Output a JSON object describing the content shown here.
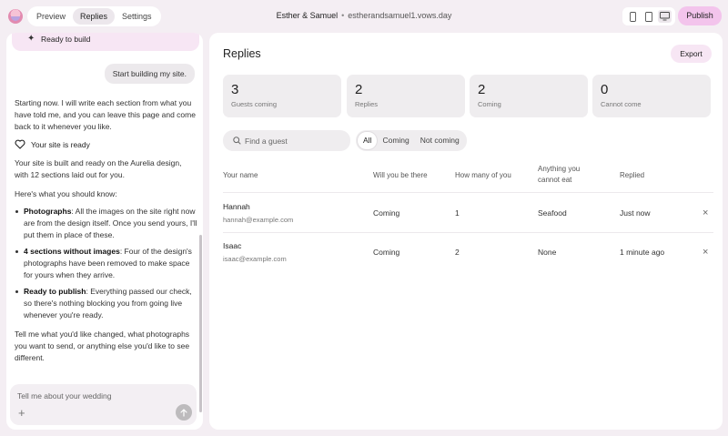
{
  "topbar": {
    "tabs": [
      {
        "label": "Preview",
        "active": false
      },
      {
        "label": "Replies",
        "active": true
      },
      {
        "label": "Settings",
        "active": false
      }
    ],
    "site_name": "Esther & Samuel",
    "separator": "•",
    "domain": "estherandsamuel1.vows.day",
    "devices": [
      "phone-icon",
      "tablet-icon",
      "desktop-icon"
    ],
    "active_device": "desktop-icon",
    "publish_label": "Publish",
    "accent_color": "#f3c4ec"
  },
  "chat": {
    "status_label": "Ready to build",
    "user_message": "Start building my site.",
    "intro": "Starting now. I will write each section from what you have told me, and you can leave this page and come back to it whenever you like.",
    "ready_label": "Your site is ready",
    "built_text": "Your site is built and ready on the Aurelia design, with 12 sections laid out for you.",
    "know_text": "Here's what you should know:",
    "bullets": [
      {
        "title": "Photographs",
        "text": ": All the images on the site right now are from the design itself. Once you send yours, I'll put them in place of these."
      },
      {
        "title": "4 sections without images",
        "text": ": Four of the design's photographs have been removed to make space for yours when they arrive."
      },
      {
        "title": "Ready to publish",
        "text": ": Everything passed our check, so there's nothing blocking you from going live whenever you're ready."
      }
    ],
    "closing": "Tell me what you'd like changed, what photographs you want to send, or anything else you'd like to see different.",
    "composer_placeholder": "Tell me about your wedding"
  },
  "replies": {
    "title": "Replies",
    "export_label": "Export",
    "stats": [
      {
        "value": "3",
        "label": "Guests coming"
      },
      {
        "value": "2",
        "label": "Replies"
      },
      {
        "value": "2",
        "label": "Coming"
      },
      {
        "value": "0",
        "label": "Cannot come"
      }
    ],
    "search_placeholder": "Find a guest",
    "filters": [
      {
        "label": "All",
        "active": true
      },
      {
        "label": "Coming",
        "active": false
      },
      {
        "label": "Not coming",
        "active": false
      }
    ],
    "columns": [
      "Your name",
      "Will you be there",
      "How many of you",
      "Anything you cannot eat",
      "Replied"
    ],
    "rows": [
      {
        "name": "Hannah",
        "email": "hannah@example.com",
        "attending": "Coming",
        "count": "1",
        "diet": "Seafood",
        "replied": "Just now"
      },
      {
        "name": "Isaac",
        "email": "isaac@example.com",
        "attending": "Coming",
        "count": "2",
        "diet": "None",
        "replied": "1 minute ago"
      }
    ]
  }
}
